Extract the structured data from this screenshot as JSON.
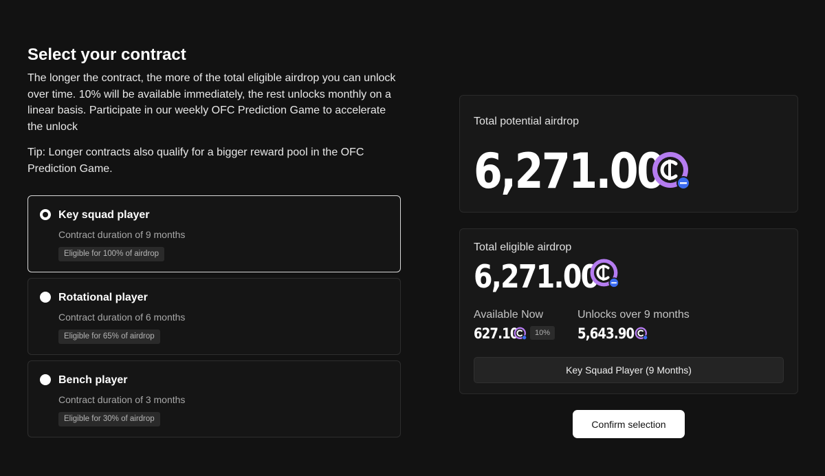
{
  "header": {
    "title": "Select your contract",
    "description": "The longer the contract, the more of the total eligible airdrop you can unlock over time. 10% will be available immediately, the rest unlocks monthly on a linear basis. Participate in our weekly OFC Prediction Game to accelerate the unlock",
    "tip": "Tip: Longer contracts also qualify for a bigger reward pool in the OFC Prediction Game."
  },
  "options": [
    {
      "title": "Key squad player",
      "duration": "Contract duration of 9 months",
      "badge": "Eligible for 100% of airdrop",
      "selected": true
    },
    {
      "title": "Rotational player",
      "duration": "Contract duration of 6 months",
      "badge": "Eligible for 65% of airdrop",
      "selected": false
    },
    {
      "title": "Bench player",
      "duration": "Contract duration of 3 months",
      "badge": "Eligible for 30% of airdrop",
      "selected": false
    }
  ],
  "potential": {
    "label": "Total potential airdrop",
    "value": "6,271.00"
  },
  "eligible": {
    "label": "Total eligible airdrop",
    "value": "6,271.00",
    "available_label": "Available Now",
    "available_value": "627.10",
    "available_pct": "10%",
    "unlock_label": "Unlocks over 9 months",
    "unlock_value": "5,643.90",
    "plan": "Key Squad Player (9 Months)"
  },
  "actions": {
    "confirm_label": "Confirm selection"
  },
  "icons": {
    "token": "ofc-token-icon"
  },
  "colors": {
    "background": "#121212",
    "coin_purple": "#b57cf0",
    "coin_badge": "#3b6cf0"
  }
}
